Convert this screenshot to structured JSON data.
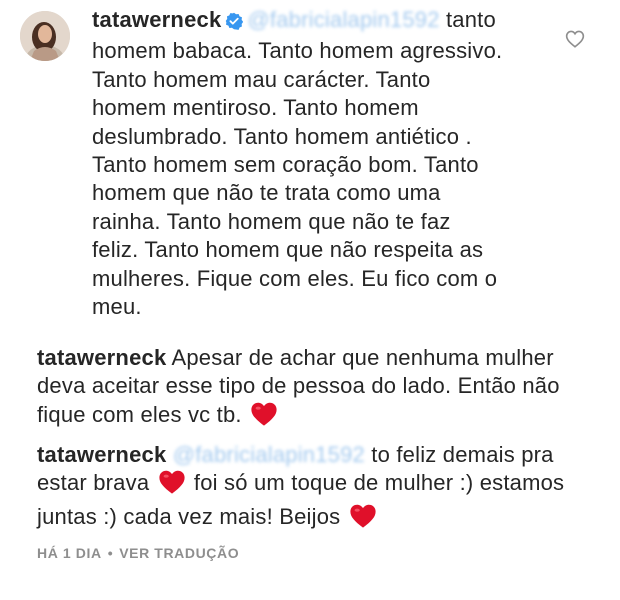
{
  "comment": {
    "username": "tatawerneck",
    "mention": "@fabricialapin1592",
    "text_line1": "tanto",
    "text_lines": [
      "homem babaca. Tanto homem agressivo.",
      "Tanto homem mau carácter. Tanto",
      "homem mentiroso. Tanto homem",
      "deslumbrado. Tanto homem antiético .",
      "Tanto homem sem coração bom. Tanto",
      "homem que não te trata como uma",
      "rainha. Tanto homem que não te faz",
      "feliz. Tanto homem que não respeita as",
      "mulheres. Fique com eles. Eu fico com o",
      "meu."
    ]
  },
  "reply1": {
    "username": "tatawerneck",
    "line1": "Apesar de achar que nenhuma mulher",
    "line2": "deva aceitar esse tipo de pessoa do lado. Então não",
    "line3": "fique com eles vc tb."
  },
  "reply2": {
    "username": "tatawerneck",
    "mention": "@fabricialapin1592",
    "line1_rest": "to feliz demais pra",
    "line2a": "estar brava",
    "line2b": "foi só um toque de mulher :) estamos",
    "line3": "juntas :) cada vez mais! Beijos"
  },
  "meta": {
    "time": "HÁ 1 DIA",
    "separator": "•",
    "translate": "VER TRADUÇÃO"
  },
  "icons": {
    "verified": "verified-badge-icon",
    "like": "heart-outline-icon",
    "emoji": "red-heart-emoji"
  },
  "colors": {
    "verified_blue": "#3897f0",
    "heart_red": "#e0102a",
    "meta_gray": "#8e8e8e"
  }
}
